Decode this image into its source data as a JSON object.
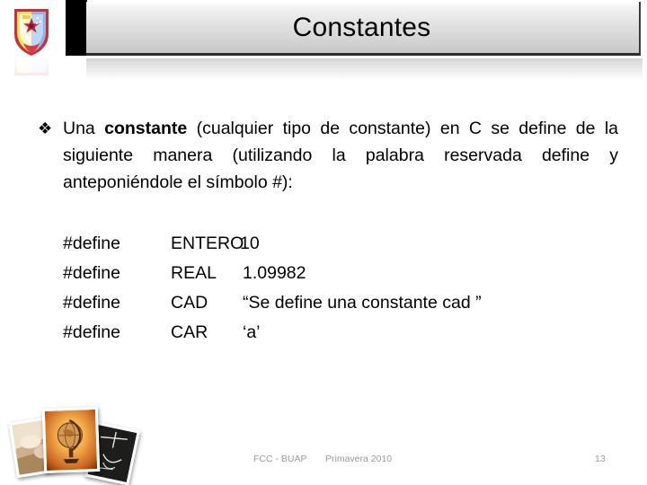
{
  "header": {
    "title": "Constantes",
    "logo_icon": "buap-crest-icon"
  },
  "body": {
    "bullet_glyph": "❖",
    "paragraph_prefix": "Una ",
    "paragraph_bold": "constante",
    "paragraph_suffix": " (cualquier tipo de constante) en C se define de la siguiente manera (utilizando la palabra reservada define y anteponiéndole el símbolo #):"
  },
  "define_table": {
    "rows": [
      {
        "directive": "#define",
        "name": "ENTERO",
        "value": "10",
        "vcol": "tight"
      },
      {
        "directive": "#define",
        "name": "REAL",
        "value": "1.09982",
        "vcol": "wide"
      },
      {
        "directive": "#define",
        "name": "CAD",
        "value": "“Se define una constante cad ”",
        "vcol": "wide"
      },
      {
        "directive": "#define",
        "name": "CAR",
        "value": "‘a’",
        "vcol": "wide"
      }
    ]
  },
  "photos": {
    "book_label": "book-photo",
    "globe_label": "globe-photo",
    "blackboard_label": "blackboard-photo",
    "chalk_plus": "+",
    "chalk_one": "1",
    "chalk_curve": "∪"
  },
  "footer": {
    "org": "FCC - BUAP",
    "term": "Primavera 2010",
    "page": "13"
  },
  "colors": {
    "title_text": "#000000",
    "body_text": "#000000",
    "footer_text": "#9a9a9a",
    "black_block": "#000000",
    "plate_top": "#ffffff",
    "plate_bottom": "#c6c6c6"
  }
}
